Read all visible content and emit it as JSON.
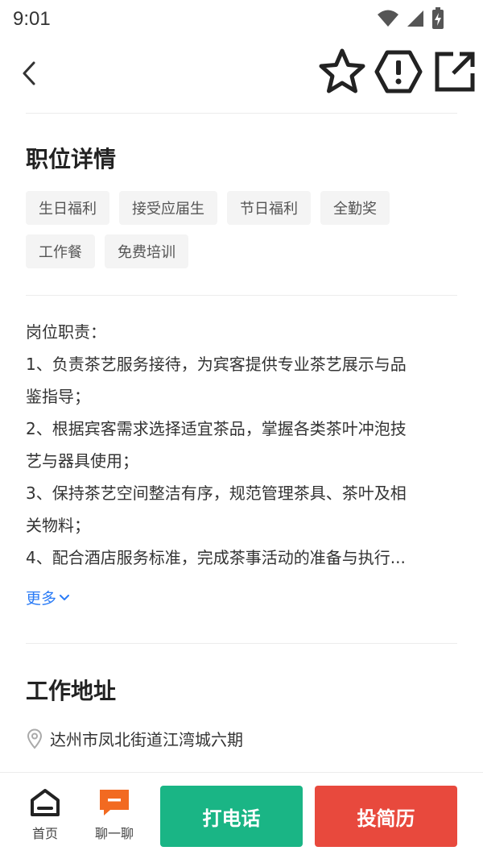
{
  "status_bar": {
    "time": "9:01",
    "icons": [
      "wifi-icon",
      "signal-icon",
      "battery-charging-icon"
    ]
  },
  "app_bar": {
    "back_icon": "chevron-left-icon",
    "actions": [
      "star-icon",
      "report-icon",
      "share-icon"
    ]
  },
  "job_details": {
    "title": "职位详情",
    "tags": [
      "生日福利",
      "接受应届生",
      "节日福利",
      "全勤奖",
      "工作餐",
      "免费培训"
    ],
    "description_lines": [
      "岗位职责：",
      "1、负责茶艺服务接待，为宾客提供专业茶艺展示与品",
      "鉴指导；",
      "2、根据宾客需求选择适宜茶品，掌握各类茶叶冲泡技",
      "艺与器具使用；",
      "3、保持茶艺空间整洁有序，规范管理茶具、茶叶及相",
      "关物料；",
      "4、配合酒店服务标准，完成茶事活动的准备与执行..."
    ],
    "more_label": "更多"
  },
  "work_address": {
    "title": "工作地址",
    "address": "达州市凤北街道江湾城六期"
  },
  "bottom_bar": {
    "home_label": "首页",
    "chat_label": "聊一聊",
    "call_label": "打电话",
    "resume_label": "投简历"
  },
  "colors": {
    "call_green": "#1ab585",
    "resume_red": "#e8493d",
    "chat_orange": "#f26a21",
    "link_blue": "#2b7cf6"
  }
}
